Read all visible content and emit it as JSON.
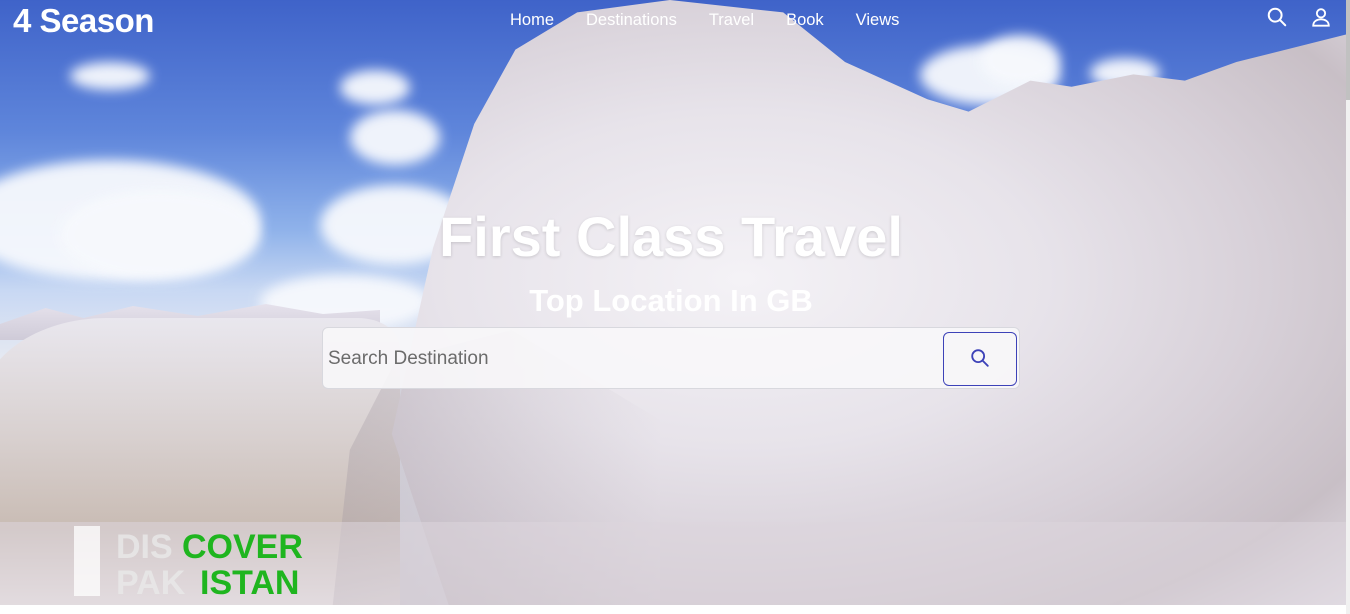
{
  "header": {
    "brand": "4 Season",
    "nav": [
      "Home",
      "Destinations",
      "Travel",
      "Book",
      "Views"
    ],
    "icons": [
      "search-icon",
      "user-icon"
    ]
  },
  "hero": {
    "title": "First Class Travel",
    "subtitle": "Top Location In GB",
    "search": {
      "placeholder": "Search Destination",
      "button_icon": "search-icon"
    }
  },
  "watermark": {
    "line1_gray": "DIS",
    "line1_green": "COVER",
    "line2_gray": "PAK",
    "line2_green": "ISTAN"
  },
  "colors": {
    "brand_text": "#ffffff",
    "accent": "#3d42b8",
    "watermark_green": "#1fb51f",
    "watermark_gray": "#e8e8e8"
  }
}
